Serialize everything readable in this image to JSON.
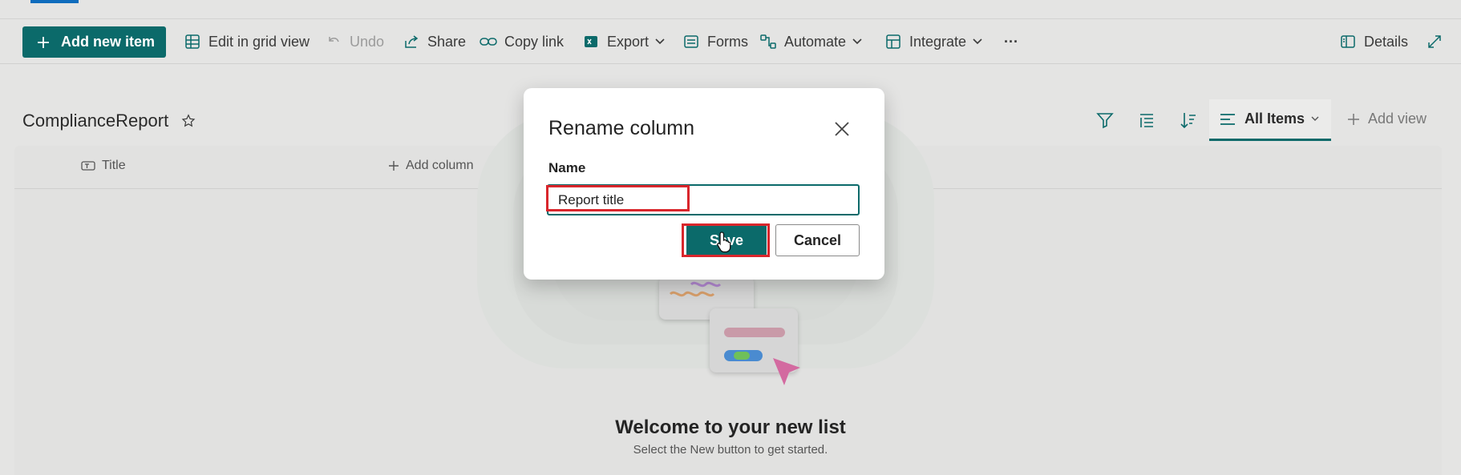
{
  "toolbar": {
    "add_new_item": "Add new item",
    "edit_grid": "Edit in grid view",
    "undo": "Undo",
    "share": "Share",
    "copy_link": "Copy link",
    "export": "Export",
    "forms": "Forms",
    "automate": "Automate",
    "integrate": "Integrate",
    "more": "···",
    "details": "Details"
  },
  "list": {
    "title": "ComplianceReport",
    "view_name": "All Items",
    "add_view": "Add view",
    "columns": [
      "Title",
      "Add column"
    ]
  },
  "empty_state": {
    "heading": "Welcome to your new list",
    "subtext": "Select the New button to get started."
  },
  "dialog": {
    "title": "Rename column",
    "field_label": "Name",
    "field_value": "Report title",
    "save_label": "Save",
    "cancel_label": "Cancel"
  },
  "colors": {
    "accent": "#0b6a6a",
    "highlight": "#d9262c"
  }
}
